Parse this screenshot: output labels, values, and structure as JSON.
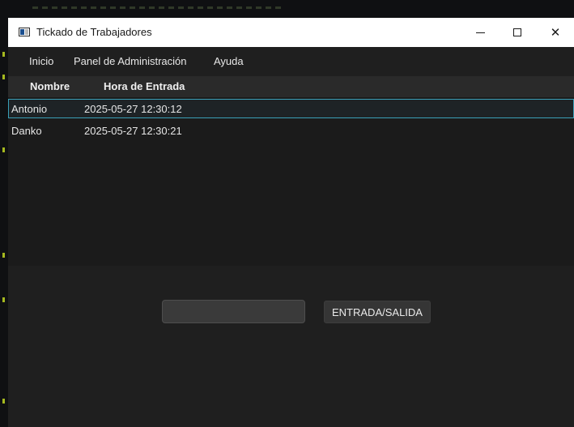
{
  "window": {
    "title": "Tickado de Trabajadores",
    "controls": {
      "minimize": "─",
      "maximize": "□",
      "close": "✕"
    }
  },
  "menubar": {
    "items": [
      {
        "label": "Inicio"
      },
      {
        "label": "Panel de Administración"
      },
      {
        "label": "Ayuda"
      }
    ]
  },
  "table": {
    "columns": [
      "Nombre",
      "Hora de Entrada"
    ],
    "rows": [
      {
        "nombre": "Antonio",
        "hora": "2025-05-27 12:30:12",
        "selected": true
      },
      {
        "nombre": "Danko",
        "hora": "2025-05-27 12:30:21",
        "selected": false
      }
    ]
  },
  "form": {
    "input_value": "",
    "input_placeholder": "",
    "action_label": "ENTRADA/SALIDA"
  },
  "colors": {
    "selection_border": "#3aa0b8",
    "window_bg": "#1f1f1f",
    "header_bg": "#2a2a2a"
  }
}
